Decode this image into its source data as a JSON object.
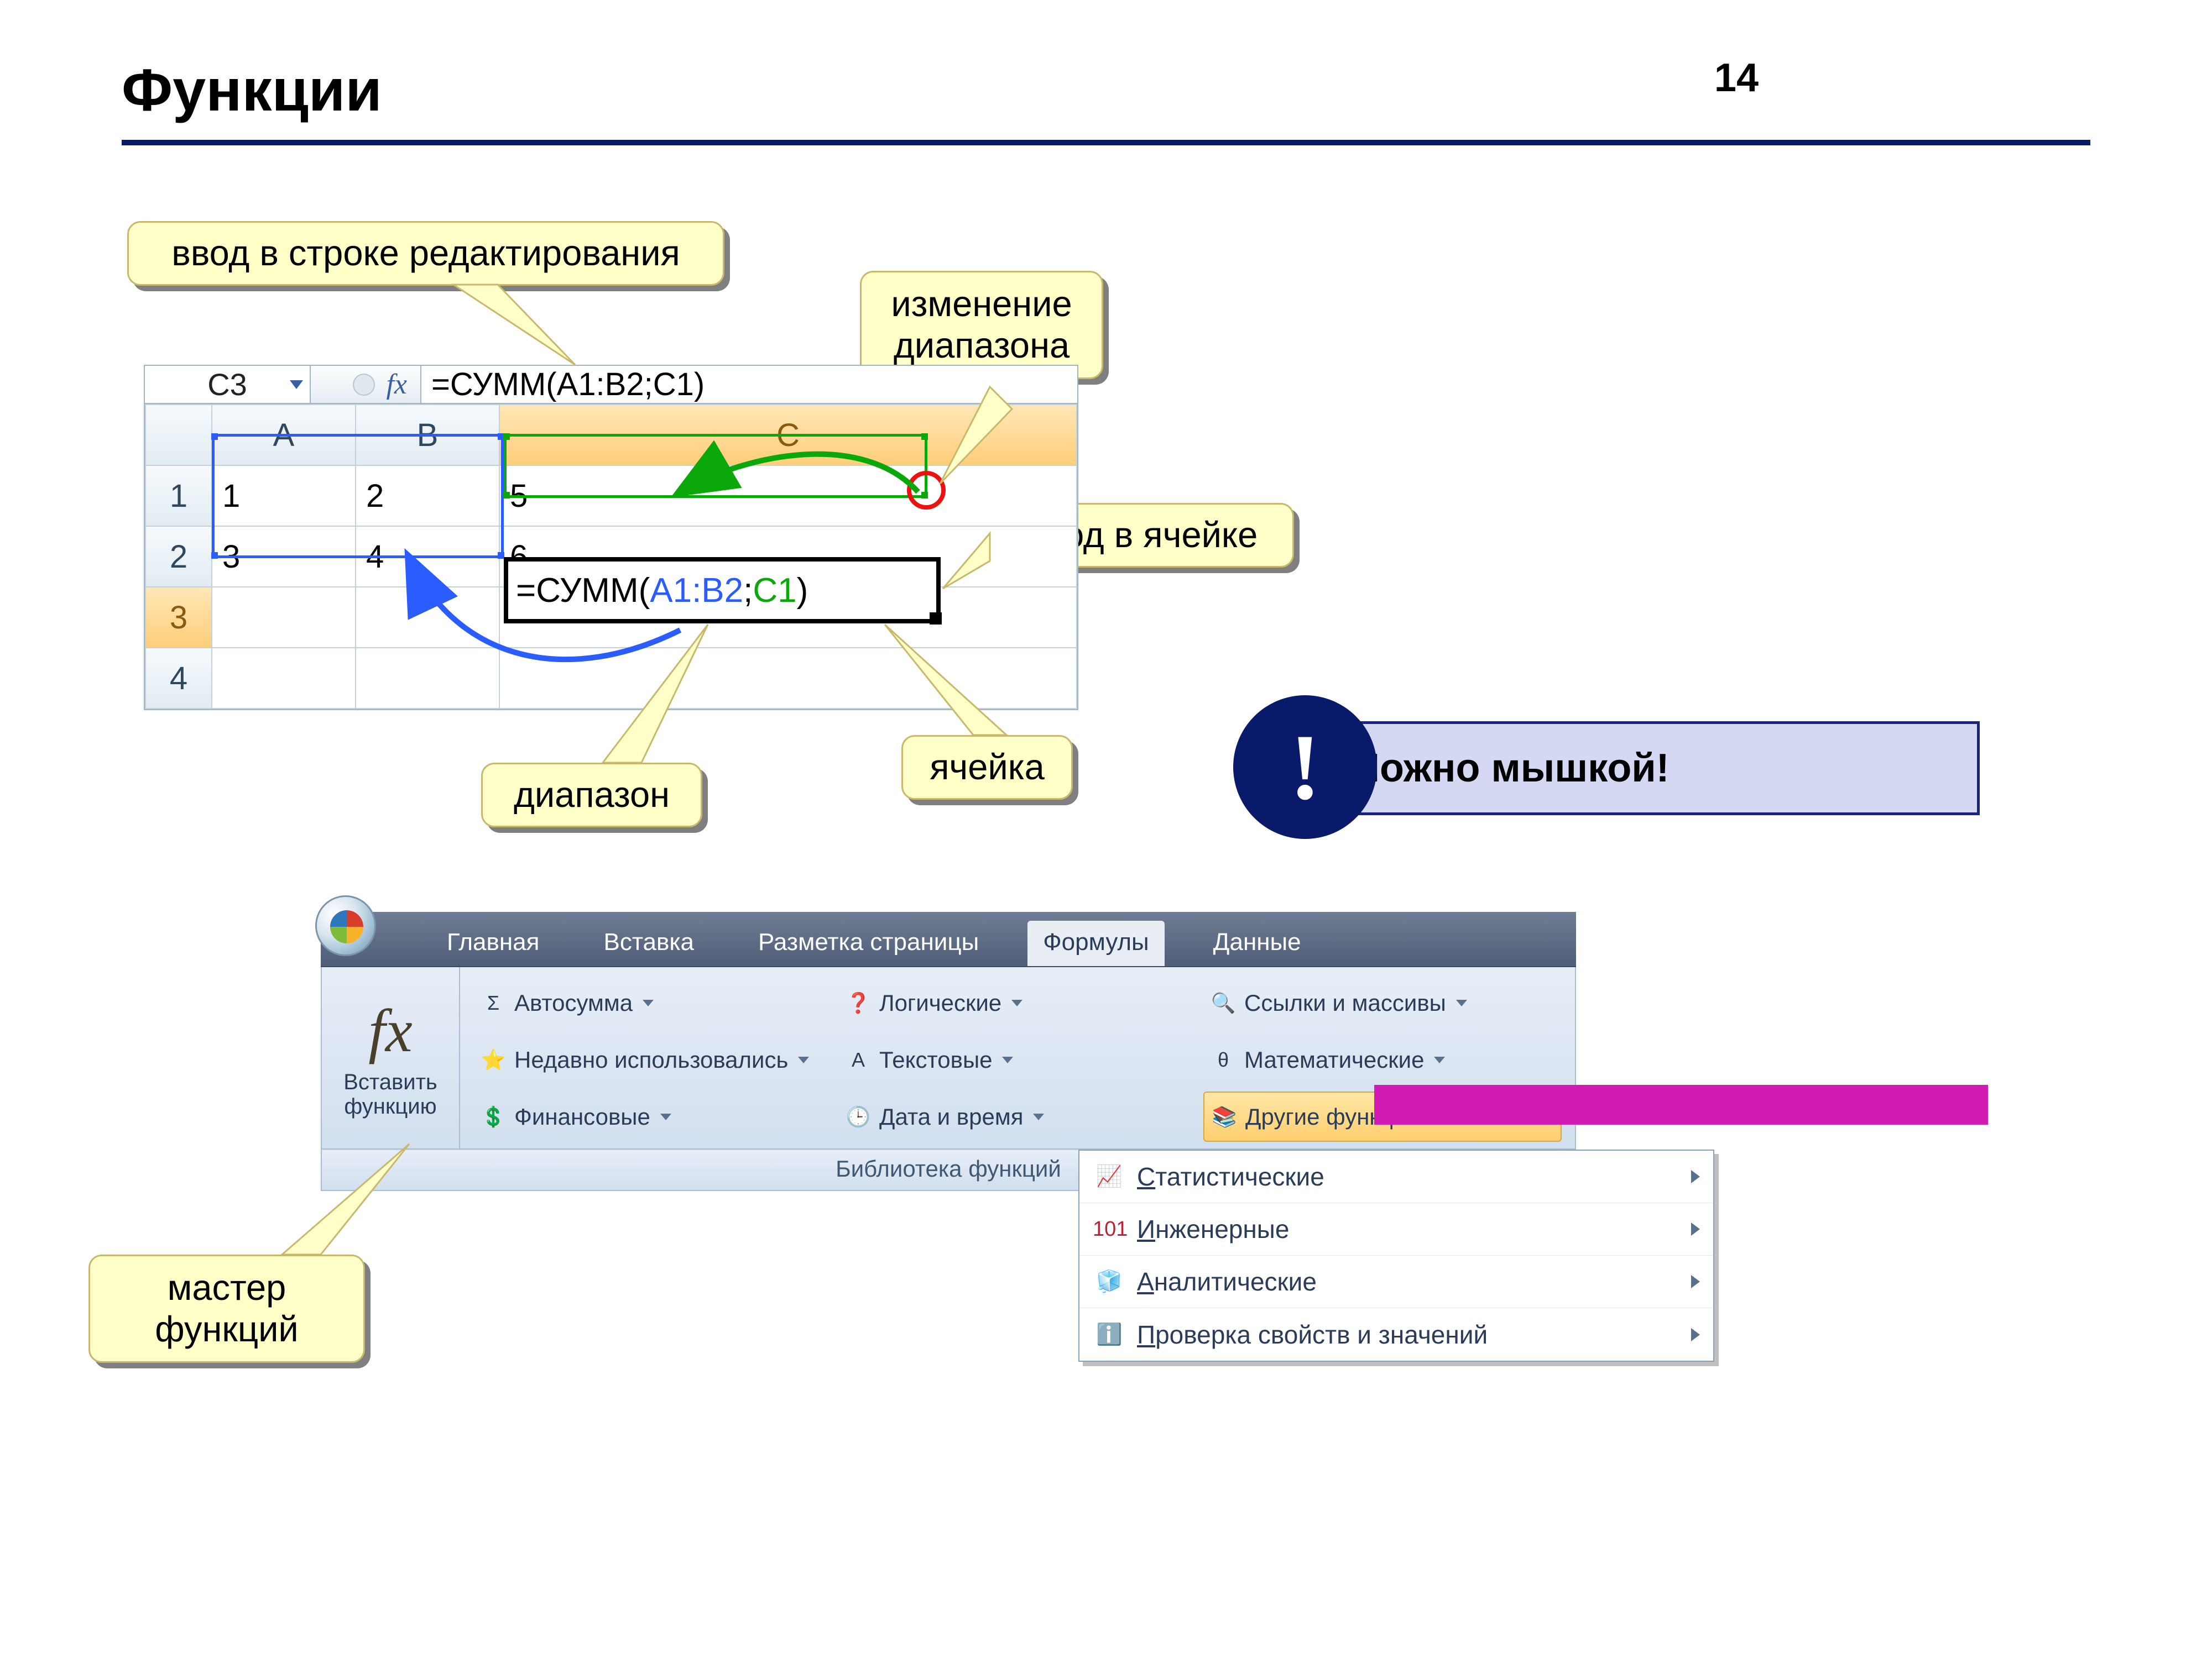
{
  "page_number": "14",
  "title": "Функции",
  "callouts": {
    "edit_line": "ввод в строке редактирования",
    "range_change_l1": "изменение",
    "range_change_l2": "диапазона",
    "cell_input": "ввод в ячейке",
    "range": "диапазон",
    "cell": "ячейка",
    "wizard_l1": "мастер",
    "wizard_l2": "функций"
  },
  "excel": {
    "namebox": "C3",
    "fx_label": "fx",
    "formula_bar": "=СУММ(A1:B2;C1)",
    "columns": {
      "a": "A",
      "b": "B",
      "c": "C"
    },
    "rows": {
      "r1": "1",
      "r2": "2",
      "r3": "3",
      "r4": "4"
    },
    "cells": {
      "a1": "1",
      "b1": "2",
      "c1": "5",
      "a2": "3",
      "b2": "4",
      "c2": "6"
    },
    "active_formula_pre": "=СУММ(",
    "active_formula_range": "A1:B2",
    "active_formula_sep": ";",
    "active_formula_cell": "C1",
    "active_formula_post": ")"
  },
  "tip": {
    "badge": "!",
    "text": "Можно мышкой!"
  },
  "ribbon": {
    "tabs": {
      "home": "Главная",
      "insert": "Вставка",
      "layout": "Разметка страницы",
      "formulas": "Формулы",
      "data": "Данные"
    },
    "insert_fn_fx": "fx",
    "insert_fn_l1": "Вставить",
    "insert_fn_l2": "функцию",
    "items": {
      "autosum": "Автосумма",
      "recent": "Недавно использовались",
      "financial": "Финансовые",
      "logical": "Логические",
      "text": "Текстовые",
      "datetime": "Дата и время",
      "lookup": "Ссылки и массивы",
      "math": "Математические",
      "other": "Другие функции"
    },
    "caption": "Библиотека функций"
  },
  "dropdown": {
    "stat_u": "С",
    "stat_rest": "татистические",
    "eng_u": "И",
    "eng_rest": "нженерные",
    "ana_u": "А",
    "ana_rest": "налитические",
    "check_u": "П",
    "check_rest": "роверка свойств и значений"
  }
}
